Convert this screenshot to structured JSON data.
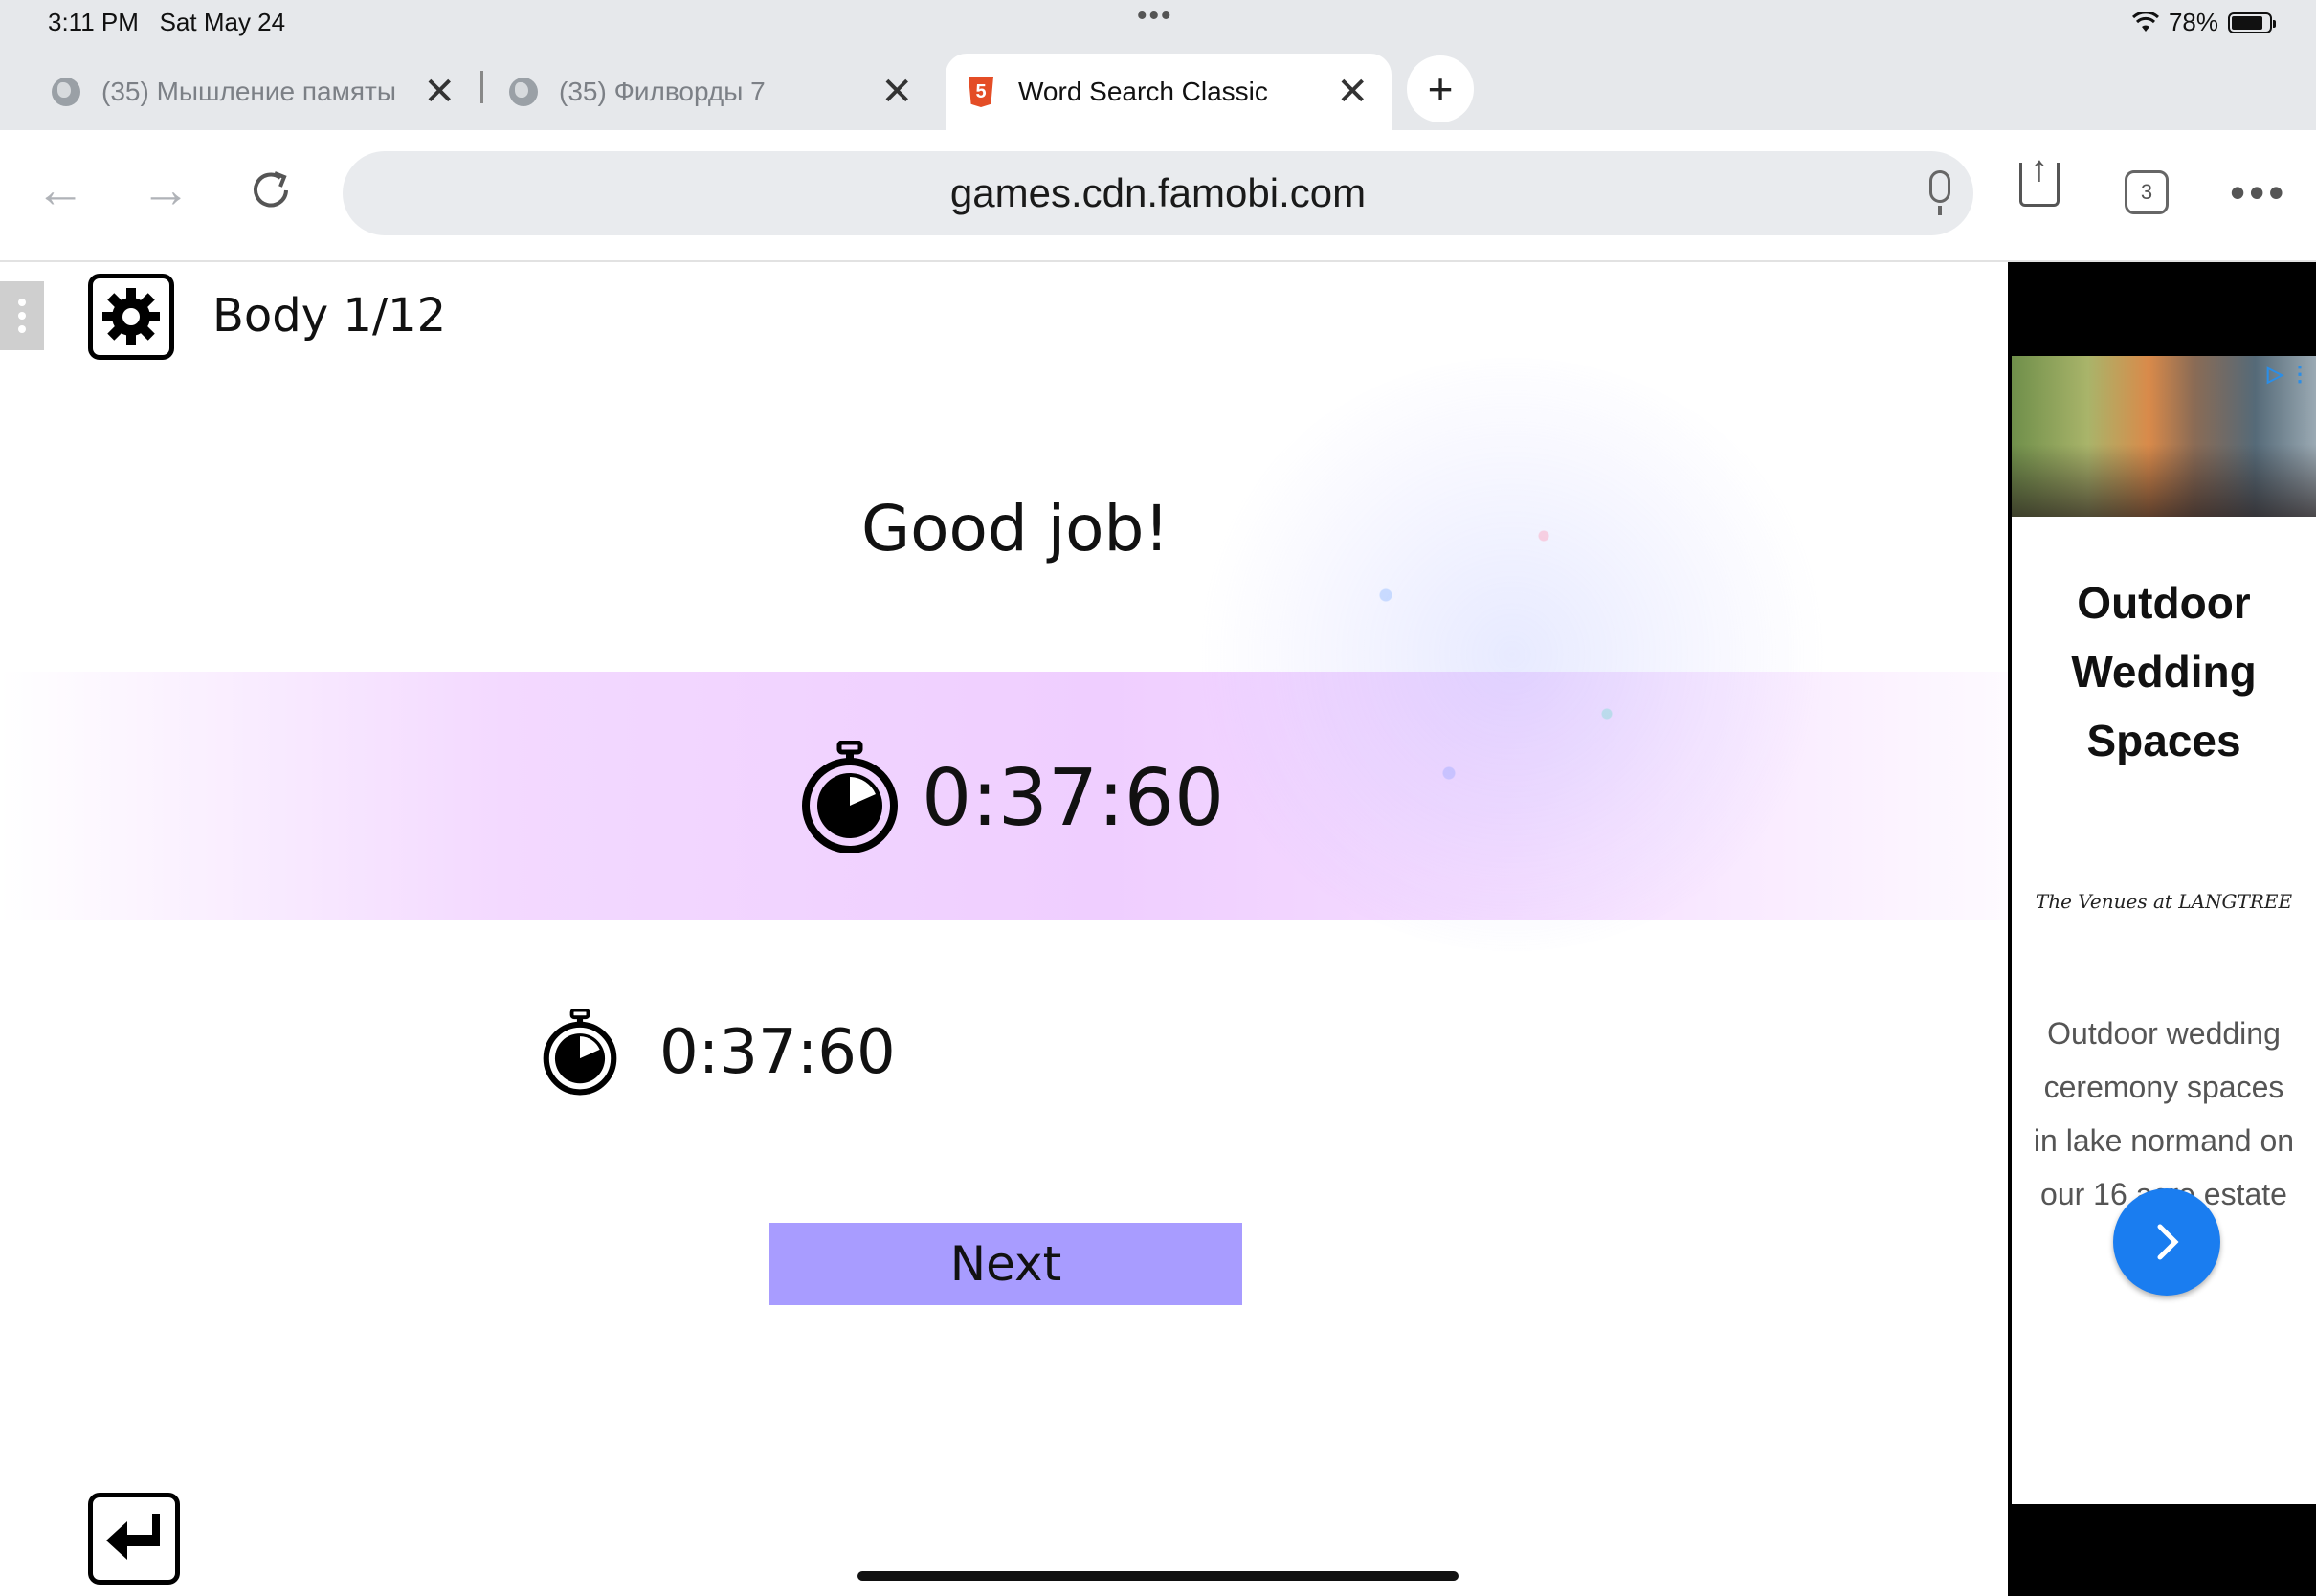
{
  "status_bar": {
    "time": "3:11 PM",
    "date": "Sat May 24",
    "battery": "78%",
    "battery_level": 0.78
  },
  "tabs": [
    {
      "title": "(35) Мышление памяты",
      "active": false,
      "icon": "globe-icon"
    },
    {
      "title": "(35) Филворды 7",
      "active": false,
      "icon": "globe-icon"
    },
    {
      "title": "Word Search Classic",
      "active": true,
      "icon": "html5-icon"
    }
  ],
  "toolbar": {
    "url": "games.cdn.famobi.com",
    "tab_count": "3"
  },
  "game": {
    "level_label": "Body 1/12",
    "message": "Good job!",
    "current_time": "0:37:60",
    "best_time": "0:37:60",
    "next_label": "Next"
  },
  "ad": {
    "title_lines": [
      "Outdoor",
      "Wedding",
      "Spaces"
    ],
    "logo": "The Venues at LANGTREE",
    "description": "Outdoor wedding ceremony spaces in lake normand on our 16 acre estate"
  },
  "colors": {
    "next_button": "#a89cff",
    "band": "#efceff",
    "ad_cta": "#1a7df0",
    "html5_badge": "#e44d26"
  }
}
